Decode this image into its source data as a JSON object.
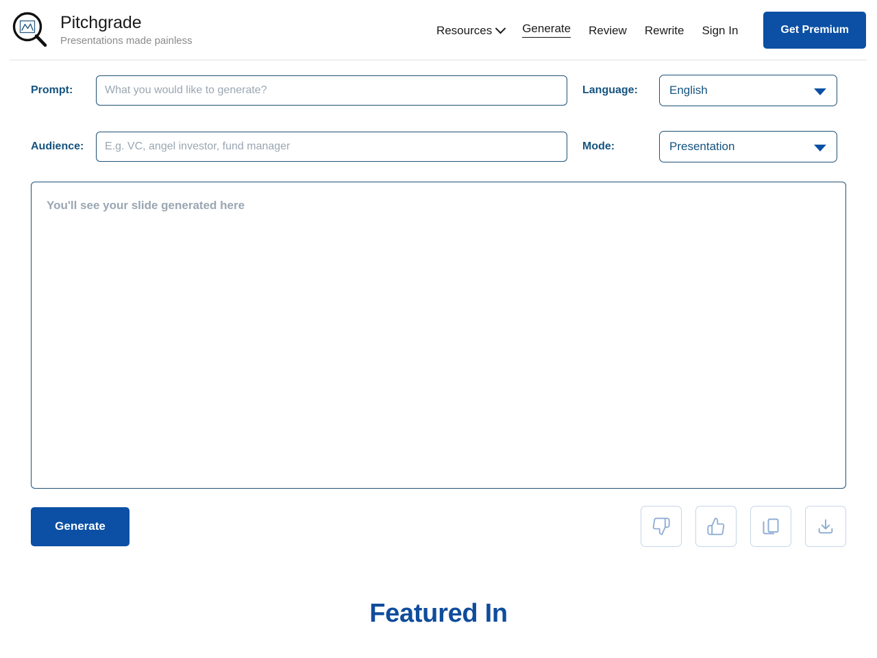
{
  "brand": {
    "title": "Pitchgrade",
    "tagline": "Presentations made painless",
    "logo_icon": "magnifier-chart-icon"
  },
  "nav": {
    "items": [
      {
        "label": "Resources",
        "has_dropdown": true,
        "active": false,
        "icon": "chevron-down-icon"
      },
      {
        "label": "Generate",
        "has_dropdown": false,
        "active": true
      },
      {
        "label": "Review",
        "has_dropdown": false,
        "active": false
      },
      {
        "label": "Rewrite",
        "has_dropdown": false,
        "active": false
      },
      {
        "label": "Sign In",
        "has_dropdown": false,
        "active": false
      }
    ],
    "premium_button": "Get Premium"
  },
  "form": {
    "prompt_label": "Prompt:",
    "prompt_placeholder": "What you would like to generate?",
    "prompt_value": "",
    "audience_label": "Audience:",
    "audience_placeholder": "E.g. VC, angel investor, fund manager",
    "audience_value": "",
    "language_label": "Language:",
    "language_value": "English",
    "mode_label": "Mode:",
    "mode_value": "Presentation"
  },
  "slide": {
    "placeholder": "You'll see your slide generated here"
  },
  "actions": {
    "generate_label": "Generate",
    "icons": [
      {
        "name": "thumbs-down-icon",
        "title": "Dislike"
      },
      {
        "name": "thumbs-up-icon",
        "title": "Like"
      },
      {
        "name": "copy-icon",
        "title": "Copy"
      },
      {
        "name": "download-icon",
        "title": "Download"
      }
    ]
  },
  "featured": {
    "title": "Featured In"
  },
  "colors": {
    "brand_blue": "#0b50a4",
    "label_blue": "#14537f",
    "border_blue": "#1c4f73",
    "placeholder_gray": "#9aa6b2",
    "icon_blue": "#8fadd4",
    "divider": "#e2e2e2"
  }
}
